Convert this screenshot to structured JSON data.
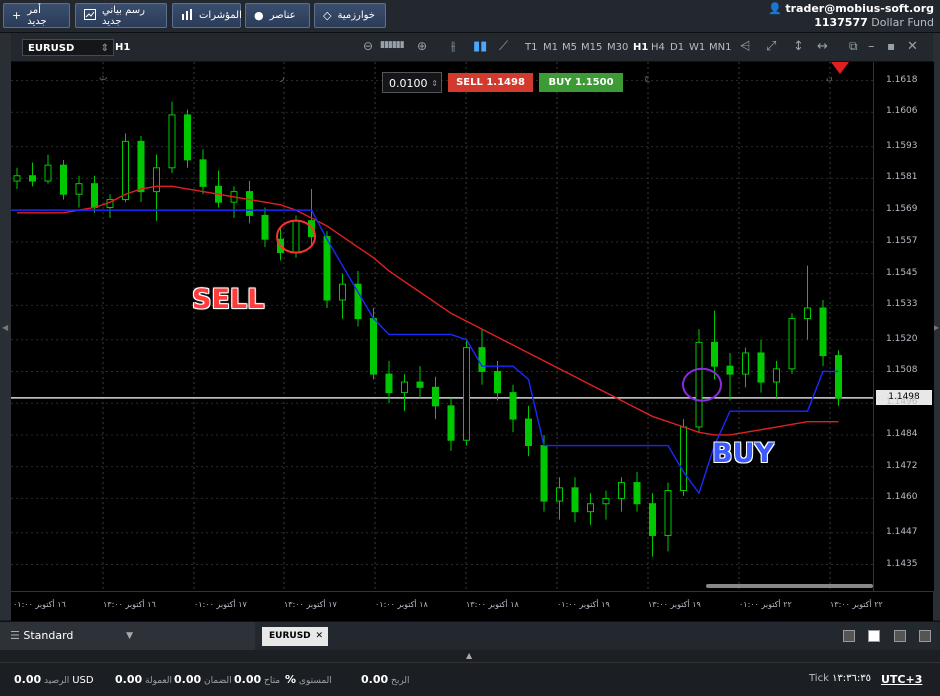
{
  "toolbar": {
    "new_order": "أمر جديد",
    "new_chart": "رسم بياني جديد",
    "indicators": "المؤشرات",
    "elements": "عناصر",
    "algorithms": "خوارزمية"
  },
  "account": {
    "user": "trader@mobius-soft.org",
    "number": "1137577",
    "fund": "Dollar Fund"
  },
  "chart_header": {
    "symbol": "EURUSD",
    "period": "H1",
    "timeframes": [
      "T1",
      "M1",
      "M5",
      "M15",
      "M30",
      "H1",
      "H4",
      "D1",
      "W1",
      "MN1"
    ],
    "active_timeframe": "H1"
  },
  "trade_panel": {
    "lot": "0.0100",
    "sell_label": "SELL",
    "sell_price": "1.1498",
    "buy_label": "BUY",
    "buy_price": "1.1500"
  },
  "annotations": {
    "sell": "SELL",
    "buy": "BUY"
  },
  "price_axis": {
    "labels": [
      "1.1618",
      "1.1606",
      "1.1593",
      "1.1581",
      "1.1569",
      "1.1557",
      "1.1545",
      "1.1533",
      "1.1520",
      "1.1508",
      "1.1496",
      "1.1484",
      "1.1472",
      "1.1460",
      "1.1447",
      "1.1435"
    ],
    "current": "1.1498"
  },
  "time_axis": {
    "labels": [
      "١٦ أكتوبر ٠١:٠٠",
      "١٦ أكتوبر ١٣:٠٠",
      "١٧ أكتوبر ٠١:٠٠",
      "١٧ أكتوبر ١٣:٠٠",
      "١٨ أكتوبر ٠١:٠٠",
      "١٨ أكتوبر ١٣:٠٠",
      "١٩ أكتوبر ٠١:٠٠",
      "١٩ أكتوبر ١٣:٠٠",
      "٢٢ أكتوبر ٠١:٠٠",
      "٢٢ أكتوبر ١٣:٠٠"
    ]
  },
  "day_markers": [
    "ث",
    "ر",
    "خ",
    "ج",
    "ن"
  ],
  "bottom_tabs": {
    "template": "Standard",
    "symbol_tab": "EURUSD"
  },
  "status": {
    "balance_label": "الرصيد",
    "balance": "0.00",
    "currency": "USD",
    "commission_label": "العمولة",
    "commission": "0.00",
    "margin_label": "الضمان",
    "margin": "0.00",
    "free_label": "متاح",
    "free": "0.00",
    "level_label": "المستوى",
    "level": "%",
    "profit_label": "الربح",
    "profit": "0.00",
    "tick_label": "Tick",
    "time": "١٣:٣٦:٣٥",
    "tz": "UTC+3"
  },
  "colors": {
    "up": "#00c800",
    "ma": "#e02020",
    "trail": "#1a2aff",
    "current_line": "#d8d8d8"
  },
  "chart_data": {
    "type": "candlestick",
    "symbol": "EURUSD",
    "timeframe": "H1",
    "price_range": [
      1.1425,
      1.1625
    ],
    "candles": [
      [
        1.158,
        1.1585,
        1.1577,
        1.1582
      ],
      [
        1.1582,
        1.1587,
        1.1578,
        1.158
      ],
      [
        1.158,
        1.159,
        1.1579,
        1.1586
      ],
      [
        1.1586,
        1.1588,
        1.1573,
        1.1575
      ],
      [
        1.1575,
        1.1582,
        1.157,
        1.1579
      ],
      [
        1.1579,
        1.1582,
        1.1568,
        1.157
      ],
      [
        1.157,
        1.1575,
        1.1566,
        1.1573
      ],
      [
        1.1573,
        1.1598,
        1.1572,
        1.1595
      ],
      [
        1.1595,
        1.1597,
        1.1572,
        1.1576
      ],
      [
        1.1576,
        1.159,
        1.1565,
        1.1585
      ],
      [
        1.1585,
        1.161,
        1.1583,
        1.1605
      ],
      [
        1.1605,
        1.1607,
        1.1585,
        1.1588
      ],
      [
        1.1588,
        1.1592,
        1.1575,
        1.1578
      ],
      [
        1.1578,
        1.1584,
        1.157,
        1.1572
      ],
      [
        1.1572,
        1.1578,
        1.1566,
        1.1576
      ],
      [
        1.1576,
        1.158,
        1.1564,
        1.1567
      ],
      [
        1.1567,
        1.157,
        1.1555,
        1.1558
      ],
      [
        1.1558,
        1.1562,
        1.155,
        1.1553
      ],
      [
        1.1553,
        1.1567,
        1.1551,
        1.1565
      ],
      [
        1.1565,
        1.1577,
        1.1556,
        1.1559
      ],
      [
        1.1559,
        1.1561,
        1.1532,
        1.1535
      ],
      [
        1.1535,
        1.1545,
        1.1528,
        1.1541
      ],
      [
        1.1541,
        1.1546,
        1.1525,
        1.1528
      ],
      [
        1.1528,
        1.1532,
        1.1505,
        1.1507
      ],
      [
        1.1507,
        1.1512,
        1.1496,
        1.15
      ],
      [
        1.15,
        1.1507,
        1.1493,
        1.1504
      ],
      [
        1.1504,
        1.151,
        1.1498,
        1.1502
      ],
      [
        1.1502,
        1.1506,
        1.149,
        1.1495
      ],
      [
        1.1495,
        1.1498,
        1.1478,
        1.1482
      ],
      [
        1.1482,
        1.152,
        1.148,
        1.1517
      ],
      [
        1.1517,
        1.1524,
        1.1503,
        1.1508
      ],
      [
        1.1508,
        1.1512,
        1.1497,
        1.15
      ],
      [
        1.15,
        1.1503,
        1.1485,
        1.149
      ],
      [
        1.149,
        1.1495,
        1.1476,
        1.148
      ],
      [
        1.148,
        1.1484,
        1.1455,
        1.1459
      ],
      [
        1.1459,
        1.1468,
        1.1452,
        1.1464
      ],
      [
        1.1464,
        1.1468,
        1.1451,
        1.1455
      ],
      [
        1.1455,
        1.1462,
        1.145,
        1.1458
      ],
      [
        1.1458,
        1.1463,
        1.1452,
        1.146
      ],
      [
        1.146,
        1.1468,
        1.1455,
        1.1466
      ],
      [
        1.1466,
        1.147,
        1.1455,
        1.1458
      ],
      [
        1.1458,
        1.1462,
        1.1438,
        1.1446
      ],
      [
        1.1446,
        1.1466,
        1.144,
        1.1463
      ],
      [
        1.1463,
        1.149,
        1.1461,
        1.1487
      ],
      [
        1.1487,
        1.1524,
        1.1485,
        1.1519
      ],
      [
        1.1519,
        1.1531,
        1.1505,
        1.151
      ],
      [
        1.151,
        1.1515,
        1.1497,
        1.1507
      ],
      [
        1.1507,
        1.1517,
        1.1502,
        1.1515
      ],
      [
        1.1515,
        1.152,
        1.15,
        1.1504
      ],
      [
        1.1504,
        1.1512,
        1.1498,
        1.1509
      ],
      [
        1.1509,
        1.153,
        1.1507,
        1.1528
      ],
      [
        1.1528,
        1.1548,
        1.152,
        1.1532
      ],
      [
        1.1532,
        1.1535,
        1.151,
        1.1514
      ],
      [
        1.1514,
        1.1516,
        1.1495,
        1.1498
      ]
    ],
    "series": [
      {
        "kind": "moving_average",
        "color": "#e02020",
        "values": [
          1.1568,
          1.1568,
          1.1568,
          1.1568,
          1.1569,
          1.157,
          1.1572,
          1.1575,
          1.1577,
          1.1578,
          1.1578,
          1.1577,
          1.1576,
          1.1575,
          1.1574,
          1.1573,
          1.1572,
          1.1571,
          1.1569,
          1.1566,
          1.1563,
          1.1559,
          1.1555,
          1.1551,
          1.1546,
          1.1542,
          1.1538,
          1.1534,
          1.153,
          1.1527,
          1.1524,
          1.1521,
          1.1518,
          1.1515,
          1.1512,
          1.1509,
          1.1506,
          1.1503,
          1.15,
          1.1497,
          1.1494,
          1.1491,
          1.1489,
          1.1487,
          1.1485,
          1.1484,
          1.1484,
          1.1485,
          1.1486,
          1.1487,
          1.1488,
          1.1489,
          1.1489,
          1.1489
        ]
      },
      {
        "kind": "trailing_stop",
        "color": "#1a2aff",
        "values": [
          1.1569,
          1.1569,
          1.1569,
          1.1569,
          1.1569,
          1.1569,
          1.1569,
          1.1569,
          1.1569,
          1.1569,
          1.1569,
          1.1569,
          1.1569,
          1.1569,
          1.1569,
          1.1569,
          1.1569,
          1.1569,
          1.1569,
          1.1569,
          1.1558,
          1.1548,
          1.1538,
          1.1528,
          1.1522,
          1.1522,
          1.1522,
          1.1522,
          1.1522,
          1.152,
          1.151,
          1.151,
          1.151,
          1.1505,
          1.148,
          1.148,
          1.148,
          1.148,
          1.148,
          1.148,
          1.148,
          1.148,
          1.148,
          1.147,
          1.1462,
          1.148,
          1.1493,
          1.1493,
          1.1493,
          1.1493,
          1.1493,
          1.1493,
          1.1508,
          1.1508
        ]
      }
    ],
    "current_price": 1.1498,
    "signals": [
      {
        "label": "SELL",
        "candle": 18
      },
      {
        "label": "BUY",
        "candle": 44
      }
    ]
  }
}
